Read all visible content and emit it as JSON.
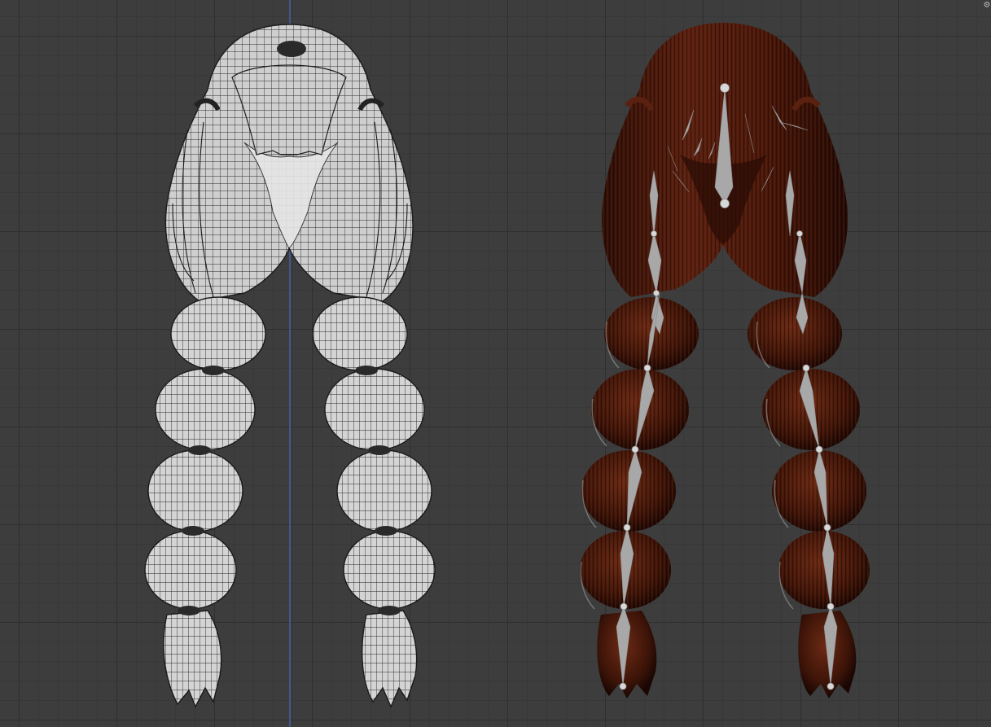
{
  "viewport": {
    "mode": "3D viewport",
    "grid": true,
    "axis_line_color": "#3f5e9b",
    "background_color": "#3d3d3d"
  },
  "models": [
    {
      "id": "hair-wireframe",
      "shading": "wireframe",
      "color": "#d9d9d9"
    },
    {
      "id": "hair-rendered",
      "shading": "material",
      "color": "#4a1a0c"
    }
  ],
  "armature": {
    "bone_color": "#a9a9a9",
    "joint_color": "#d8d8d8"
  },
  "icons": {
    "corner": "gizmo-icon"
  }
}
